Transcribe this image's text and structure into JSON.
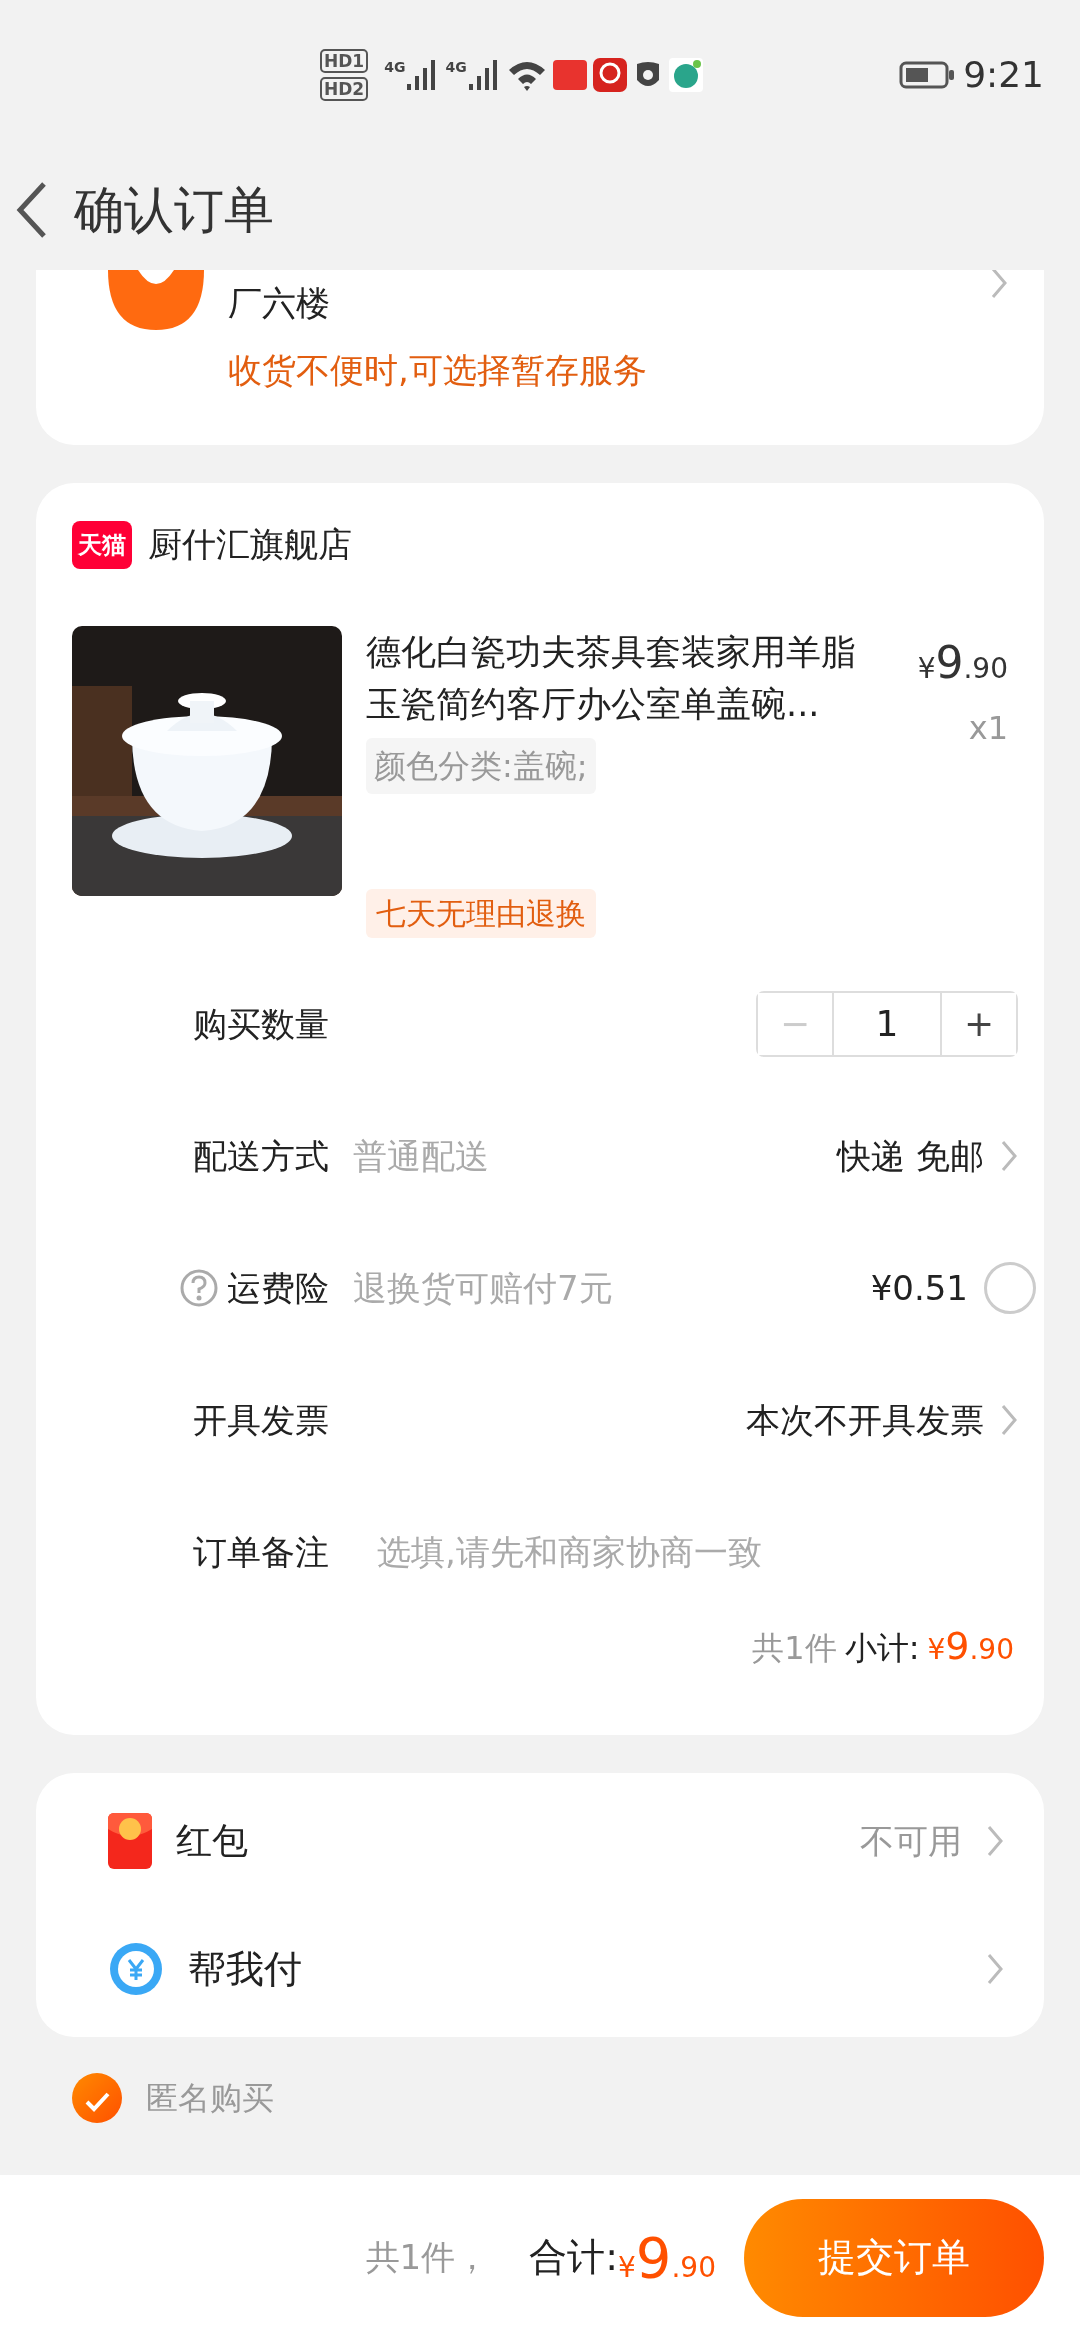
{
  "status_bar": {
    "sim_labels": [
      "HD1",
      "HD2"
    ],
    "network_labels": [
      "4G",
      "4G"
    ],
    "time": "9:21"
  },
  "header": {
    "title": "确认订单"
  },
  "address": {
    "line": "厂六楼",
    "notice": "收货不便时,可选择暂存服务"
  },
  "store": {
    "badge": "天猫",
    "name": "厨什汇旗舰店"
  },
  "product": {
    "title": "德化白瓷功夫茶具套装家用羊脂玉瓷简约客厅办公室单盖碗...",
    "sku": "颜色分类:盖碗;",
    "price": {
      "currency": "¥",
      "integer": "9",
      "decimal": ".90"
    },
    "quantity": "x1",
    "tag": "七天无理由退换"
  },
  "rows": [
    {
      "kind": "quantity",
      "label": "购买数量",
      "decrement": {
        "symbol": "−",
        "disabled": true
      },
      "value": "1",
      "increment": {
        "symbol": "+",
        "disabled": false
      }
    },
    {
      "kind": "delivery",
      "label": "配送方式",
      "detail": "普通配送",
      "value": "快递 免邮"
    },
    {
      "kind": "insurance",
      "label": "运费险",
      "detail": "退换货可赔付7元",
      "value": "¥0.51",
      "checked": false
    },
    {
      "kind": "invoice",
      "label": "开具发票",
      "value": "本次不开具发票"
    },
    {
      "kind": "note",
      "label": "订单备注",
      "placeholder": "选填,请先和商家协商一致"
    }
  ],
  "subtotal": {
    "count": "共1件",
    "label": "小计:",
    "price": {
      "currency": "¥",
      "integer": "9",
      "decimal": ".90"
    }
  },
  "benefits": [
    {
      "kind": "red_packet",
      "label": "红包",
      "value": "不可用"
    },
    {
      "kind": "pay_for_me",
      "label": "帮我付"
    }
  ],
  "anonymous": {
    "label": "匿名购买",
    "checked": true
  },
  "footer": {
    "count": "共1件，",
    "label": "合计:",
    "price": {
      "currency": "¥",
      "integer": "9",
      "decimal": ".90"
    },
    "submit": "提交订单"
  }
}
